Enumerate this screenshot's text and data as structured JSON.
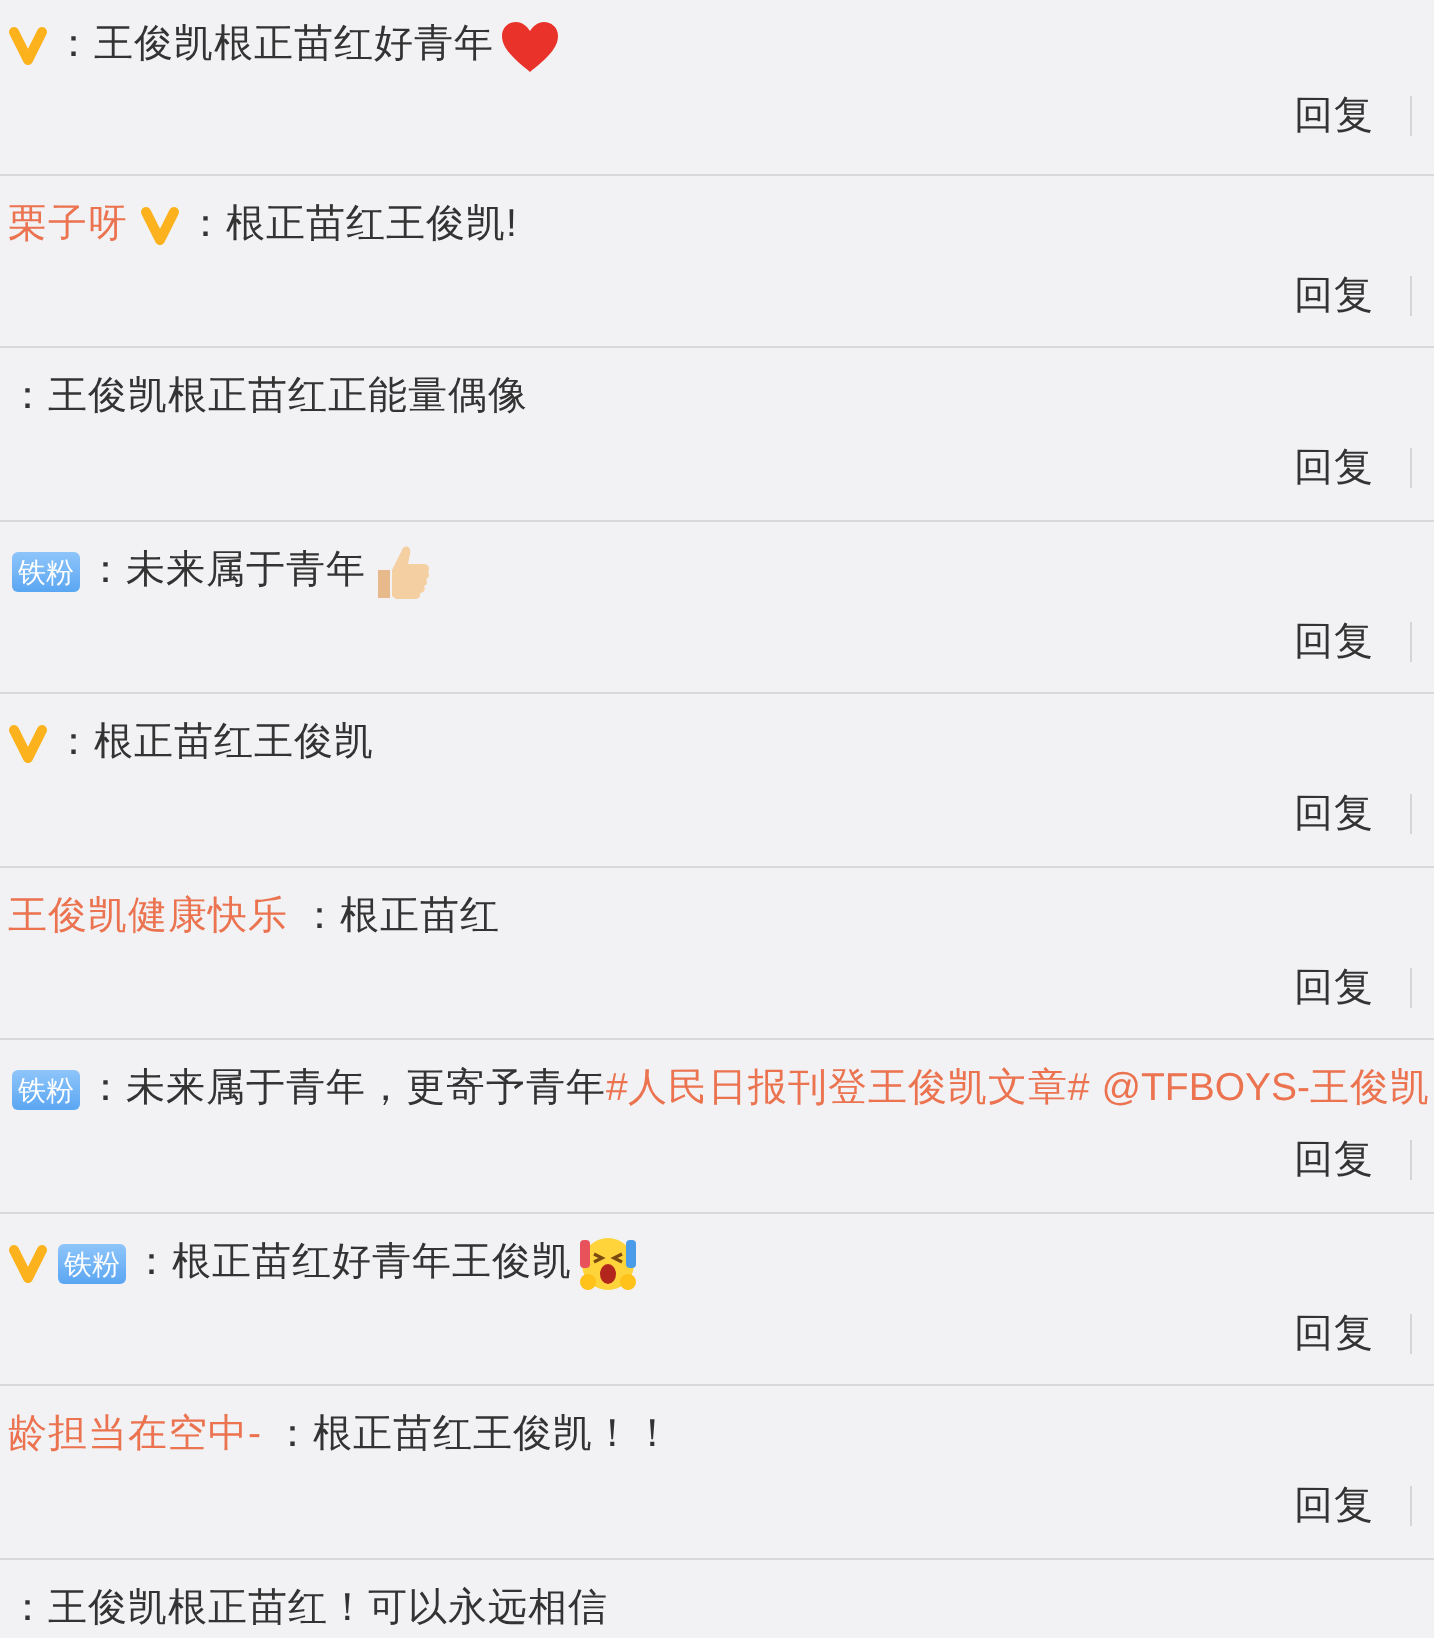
{
  "comments": [
    {
      "verified": true,
      "content": [
        {
          "kind": "plain",
          "text": "：王俊凯根正苗红好青年"
        }
      ],
      "emoji": {
        "kind": "heart"
      },
      "reply": "回复"
    },
    {
      "user": "栗子呀",
      "verified": true,
      "content": [
        {
          "kind": "plain",
          "text": "：根正苗红王俊凯!"
        }
      ],
      "reply": "回复"
    },
    {
      "verified": false,
      "content": [
        {
          "kind": "plain",
          "text": "：王俊凯根正苗红正能量偶像"
        }
      ],
      "reply": "回复"
    },
    {
      "verified": false,
      "badge": "铁粉",
      "content": [
        {
          "kind": "plain",
          "text": "：未来属于青年"
        }
      ],
      "emoji": {
        "kind": "thumbs-up"
      },
      "reply": "回复"
    },
    {
      "verified": true,
      "content": [
        {
          "kind": "plain",
          "text": "：根正苗红王俊凯"
        }
      ],
      "reply": "回复"
    },
    {
      "user": "王俊凯健康快乐",
      "verified": false,
      "content": [
        {
          "kind": "plain",
          "text": "：根正苗红"
        }
      ],
      "reply": "回复"
    },
    {
      "verified": false,
      "badge": "铁粉",
      "content": [
        {
          "kind": "plain",
          "text": "：未来属于青年，更寄予青年"
        },
        {
          "kind": "hashtag",
          "text": "#人民日报刊登王俊凯文章#"
        },
        {
          "kind": "mention",
          "text": "@TFBOYS-王俊凯"
        }
      ],
      "reply": "回复"
    },
    {
      "verified": true,
      "badge": "铁粉",
      "content": [
        {
          "kind": "plain",
          "text": "：根正苗红好青年王俊凯"
        }
      ],
      "emoji": {
        "kind": "screaming-face"
      },
      "reply": "回复"
    },
    {
      "user": "龄担当在空中-",
      "verified": false,
      "content": [
        {
          "kind": "plain",
          "text": "：根正苗红王俊凯！！"
        }
      ],
      "reply": "回复"
    },
    {
      "verified": false,
      "content": [
        {
          "kind": "plain",
          "text": "：王俊凯根正苗红！可以永远相信"
        }
      ]
    }
  ]
}
